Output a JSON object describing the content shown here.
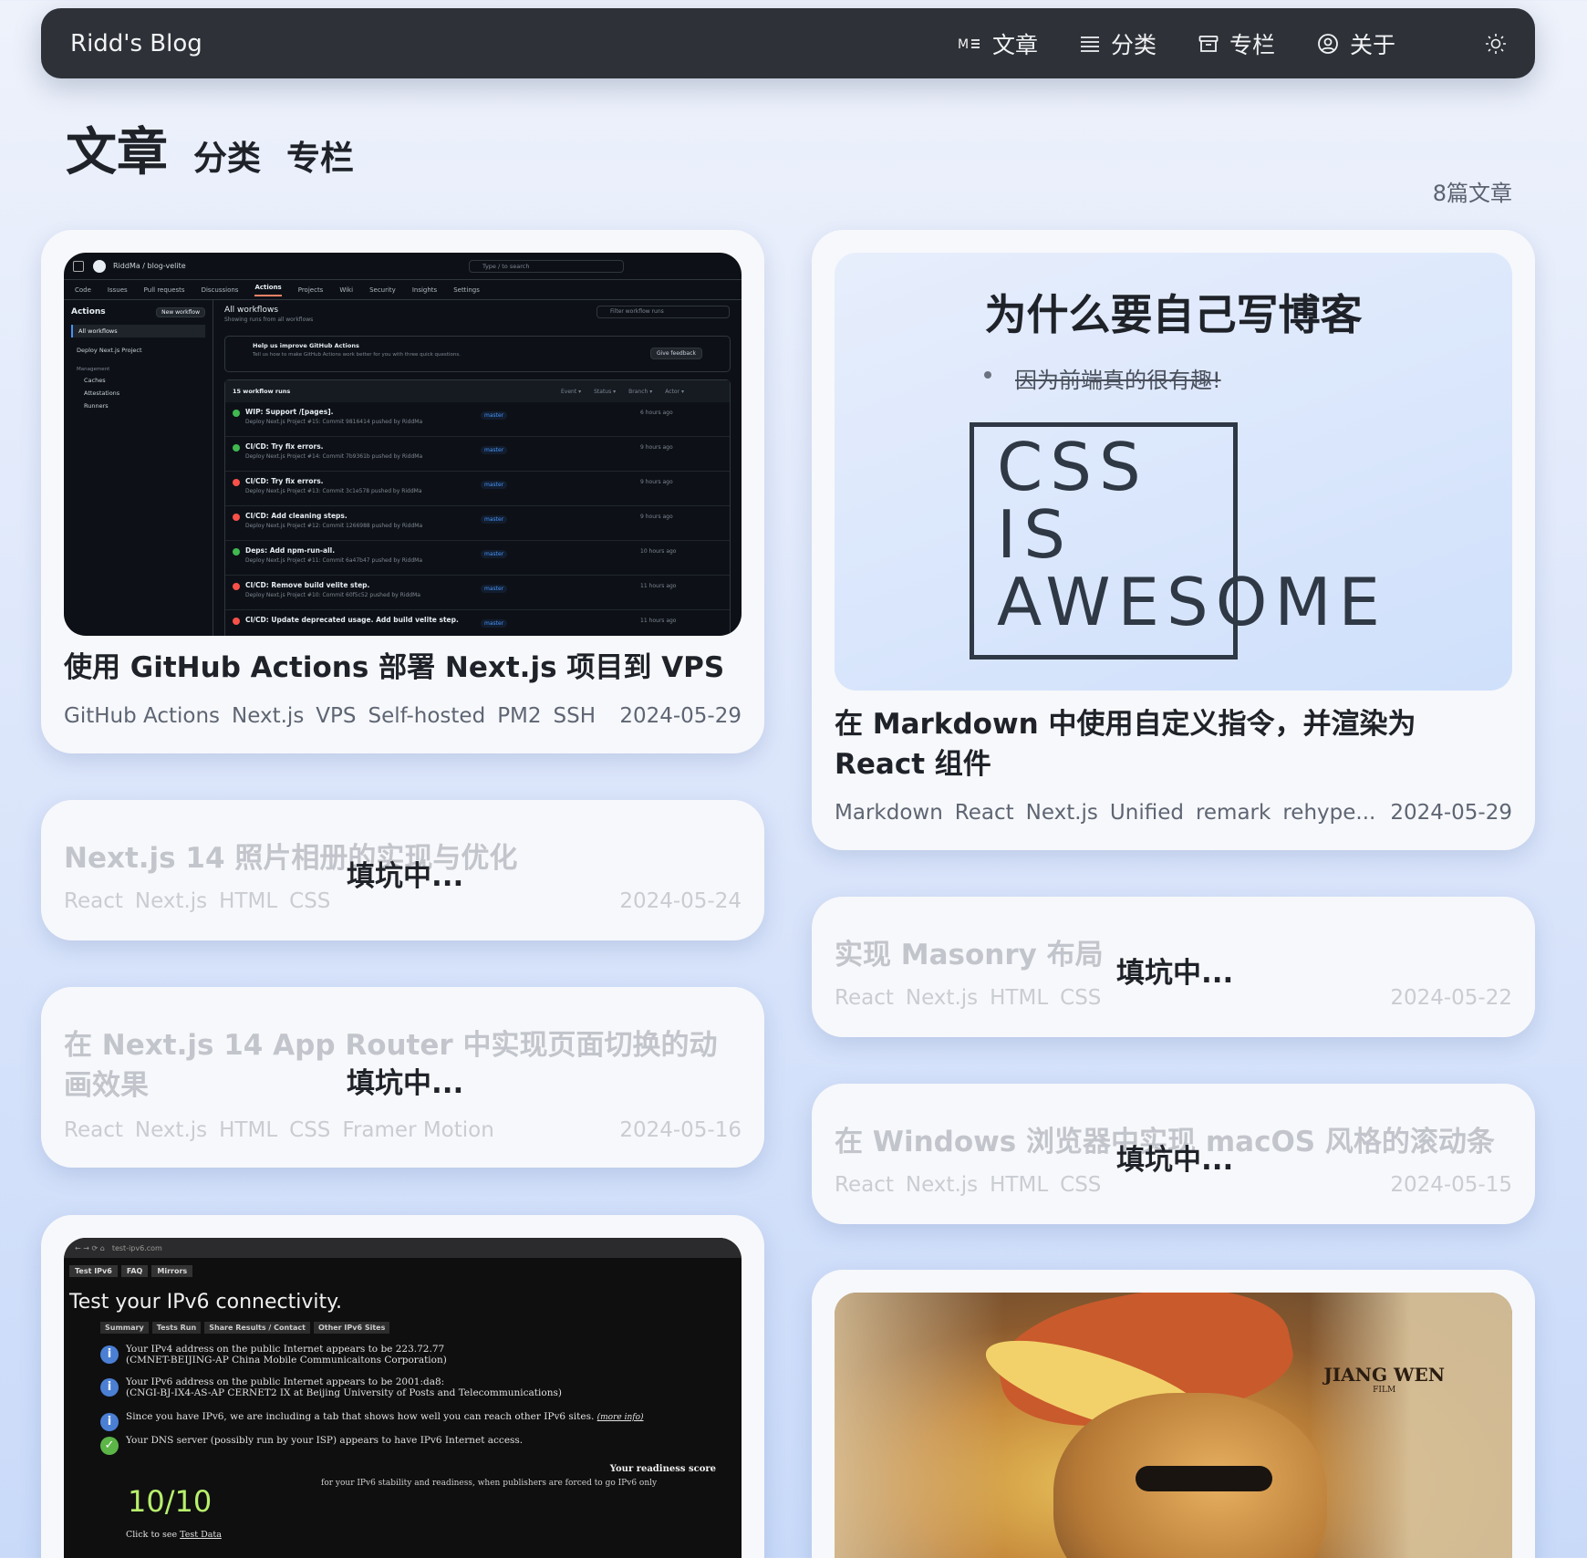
{
  "nav": {
    "brand": "Ridd's Blog",
    "links": [
      {
        "label": "文章",
        "icon": "markdown-icon"
      },
      {
        "label": "分类",
        "icon": "list-icon"
      },
      {
        "label": "专栏",
        "icon": "archive-box-icon"
      },
      {
        "label": "关于",
        "icon": "user-circle-icon"
      }
    ],
    "theme_icon": "sun-icon"
  },
  "page": {
    "tabs": [
      "文章",
      "分类",
      "专栏"
    ],
    "count": "8篇文章"
  },
  "cards": {
    "c1": {
      "title": "使用 GitHub Actions 部署 Next.js 项目到 VPS",
      "tags": [
        "GitHub Actions",
        "Next.js",
        "VPS",
        "Self-hosted",
        "PM2",
        "SSH"
      ],
      "date": "2024-05-29",
      "cover": {
        "repo": "RiddMa / blog-velite",
        "search": "Type / to search",
        "tabs": [
          "Code",
          "Issues",
          "Pull requests",
          "Discussions",
          "Actions",
          "Projects",
          "Wiki",
          "Security",
          "Insights",
          "Settings"
        ],
        "side_title": "Actions",
        "new_workflow": "New workflow",
        "side_items": [
          "All workflows",
          "Deploy Next.js Project",
          "Management",
          "Caches",
          "Attestations",
          "Runners"
        ],
        "main_title": "All workflows",
        "main_sub": "Showing runs from all workflows",
        "filter": "Filter workflow runs",
        "banner_title": "Help us improve GitHub Actions",
        "banner_sub": "Tell us how to make GitHub Actions work better for you with three quick questions.",
        "feedback": "Give feedback",
        "runs_count": "15 workflow runs",
        "filters": [
          "Event ▾",
          "Status ▾",
          "Branch ▾",
          "Actor ▾"
        ],
        "runs": [
          {
            "title": "WIP: Support /[pages].",
            "sub": "Deploy Next.js Project #15: Commit 9816414 pushed by RiddMa",
            "branch": "master",
            "time": "6 hours ago",
            "ok": true
          },
          {
            "title": "CI/CD: Try fix errors.",
            "sub": "Deploy Next.js Project #14: Commit 7b9361b pushed by RiddMa",
            "branch": "master",
            "time": "9 hours ago",
            "ok": true
          },
          {
            "title": "CI/CD: Try fix errors.",
            "sub": "Deploy Next.js Project #13: Commit 3c1e578 pushed by RiddMa",
            "branch": "master",
            "time": "9 hours ago",
            "ok": false
          },
          {
            "title": "CI/CD: Add cleaning steps.",
            "sub": "Deploy Next.js Project #12: Commit 1266988 pushed by RiddMa",
            "branch": "master",
            "time": "9 hours ago",
            "ok": false
          },
          {
            "title": "Deps: Add npm-run-all.",
            "sub": "Deploy Next.js Project #11: Commit 6a47b47 pushed by RiddMa",
            "branch": "master",
            "time": "10 hours ago",
            "ok": true
          },
          {
            "title": "CI/CD: Remove build velite step.",
            "sub": "Deploy Next.js Project #10: Commit 60f5c52 pushed by RiddMa",
            "branch": "master",
            "time": "11 hours ago",
            "ok": false
          },
          {
            "title": "CI/CD: Update deprecated usage. Add build velite step.",
            "sub": "",
            "branch": "master",
            "time": "11 hours ago",
            "ok": false
          }
        ]
      }
    },
    "c2": {
      "title": "在 Markdown 中使用自定义指令，并渲染为 React 组件",
      "tags": [
        "Markdown",
        "React",
        "Next.js",
        "Unified",
        "remark",
        "rehype..."
      ],
      "date": "2024-05-29",
      "cover": {
        "heading": "为什么要自己写博客",
        "strike": "因为前端真的很有趣!",
        "words": [
          "CSS",
          "IS",
          "AWESOME"
        ]
      }
    },
    "c3": {
      "title": "Next.js 14 照片相册的实现与优化",
      "tags": [
        "React",
        "Next.js",
        "HTML",
        "CSS"
      ],
      "date": "2024-05-24",
      "overlay": "填坑中..."
    },
    "c4": {
      "title": "实现 Masonry 布局",
      "tags": [
        "React",
        "Next.js",
        "HTML",
        "CSS"
      ],
      "date": "2024-05-22",
      "overlay": "填坑中..."
    },
    "c5": {
      "title": "在 Next.js 14 App Router 中实现页面切换的动画效果",
      "tags": [
        "React",
        "Next.js",
        "HTML",
        "CSS",
        "Framer Motion"
      ],
      "date": "2024-05-16",
      "overlay": "填坑中..."
    },
    "c6": {
      "title": "在 Windows 浏览器中实现 macOS 风格的滚动条",
      "tags": [
        "React",
        "Next.js",
        "HTML",
        "CSS"
      ],
      "date": "2024-05-15",
      "overlay": "填坑中..."
    },
    "c7": {
      "cover": {
        "url": "test-ipv6.com",
        "tabs": [
          "Test IPv6",
          "FAQ",
          "Mirrors"
        ],
        "heading": "Test your IPv6 connectivity.",
        "subtabs": [
          "Summary",
          "Tests Run",
          "Share Results / Contact",
          "Other IPv6 Sites"
        ],
        "lines": [
          "Your IPv4 address on the public Internet appears to be 223.72.77",
          "(CMNET-BEIJING-AP China Mobile Communicaitons Corporation)",
          "Your IPv6 address on the public Internet appears to be 2001:da8:",
          "(CNGI-BJ-IX4-AS-AP CERNET2 IX at Beijing University of Posts and Telecommunications)",
          "Since you have IPv6, we are including a tab that shows how well you can reach other IPv6 sites.",
          "(more info)",
          "Your DNS server (possibly run by your ISP) appears to have IPv6 Internet access."
        ],
        "readiness_label": "Your readiness score",
        "readiness_sub": "for your IPv6 stability and readiness, when publishers are forced to go IPv6 only",
        "score": "10/10",
        "click_label": "Click to see",
        "test_data": "Test Data"
      }
    },
    "c8": {
      "cover": {
        "logo": "JIANG WEN",
        "logo_sub": "FILM"
      }
    }
  },
  "colors": {
    "nav_bg": "#2e3238",
    "page_bg": "#dfe8fb",
    "card_bg": "#f7f8fb",
    "success": "#3fb950",
    "failure": "#f85149"
  }
}
